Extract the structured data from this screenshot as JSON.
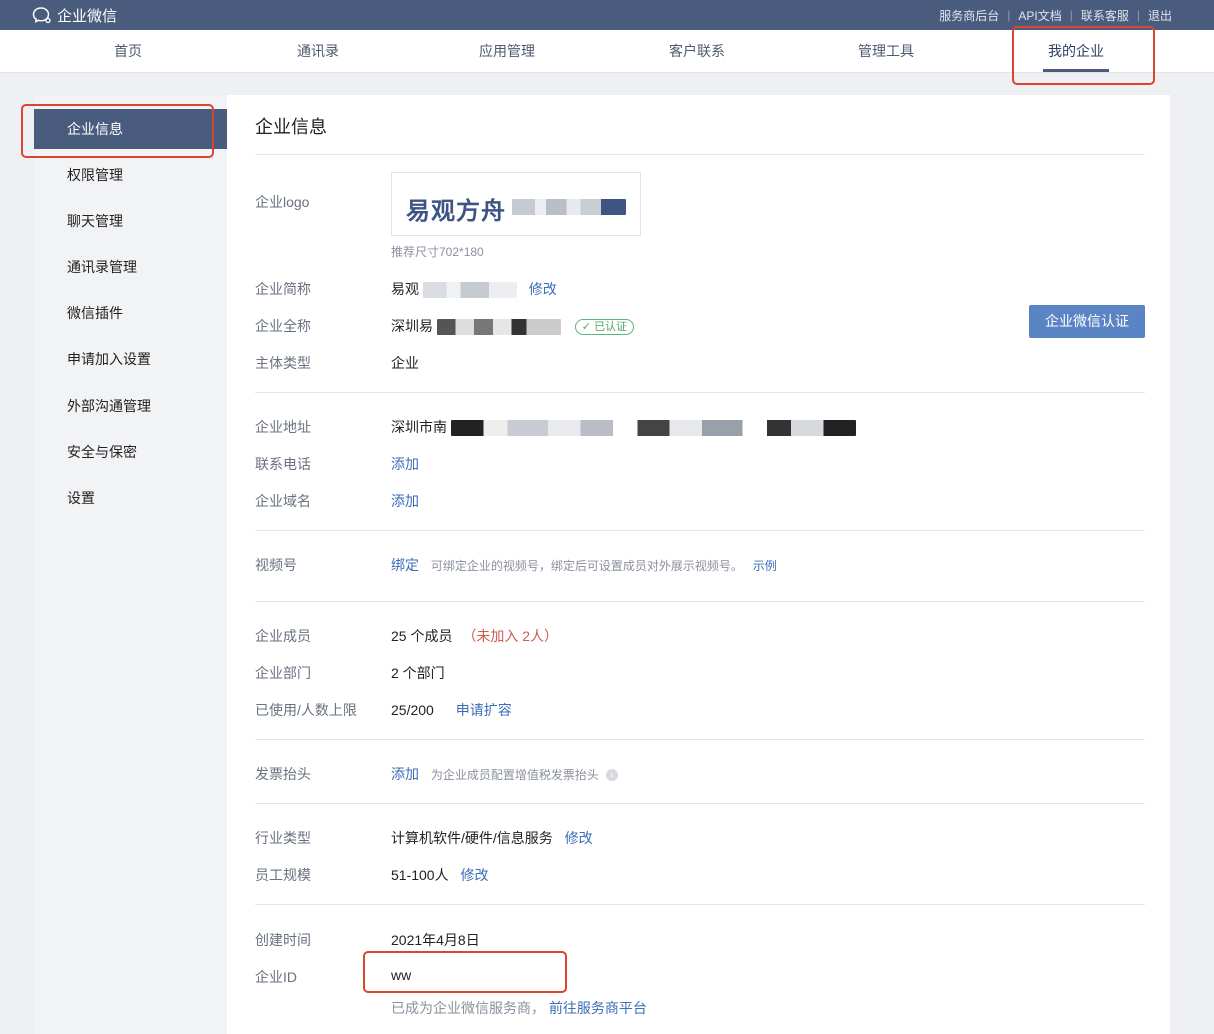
{
  "topbar": {
    "brand": "企业微信",
    "links": [
      "服务商后台",
      "API文档",
      "联系客服",
      "退出"
    ]
  },
  "nav": {
    "items": [
      "首页",
      "通讯录",
      "应用管理",
      "客户联系",
      "管理工具",
      "我的企业"
    ],
    "active_index": 5
  },
  "sidebar": {
    "items": [
      "企业信息",
      "权限管理",
      "聊天管理",
      "通讯录管理",
      "微信插件",
      "申请加入设置",
      "外部沟通管理",
      "安全与保密",
      "设置"
    ],
    "active_index": 0
  },
  "content": {
    "title": "企业信息",
    "logo": {
      "label": "企业logo",
      "text": "易观方舟",
      "hint": "推荐尺寸702*180"
    },
    "short_name": {
      "label": "企业简称",
      "value": "易观",
      "action": "修改"
    },
    "full_name": {
      "label": "企业全称",
      "value": "深圳易",
      "badge": "已认证"
    },
    "verify_button": "企业微信认证",
    "subject_type": {
      "label": "主体类型",
      "value": "企业"
    },
    "address": {
      "label": "企业地址",
      "value": "深圳市南"
    },
    "phone": {
      "label": "联系电话",
      "action": "添加"
    },
    "domain": {
      "label": "企业域名",
      "action": "添加"
    },
    "video": {
      "label": "视频号",
      "action": "绑定",
      "hint": "可绑定企业的视频号，绑定后可设置成员对外展示视频号。",
      "example": "示例"
    },
    "members": {
      "label": "企业成员",
      "value": "25 个成员",
      "not_joined": "（未加入 2人）"
    },
    "departments": {
      "label": "企业部门",
      "value": "2 个部门"
    },
    "usage": {
      "label": "已使用/人数上限",
      "value": "25/200",
      "action": "申请扩容"
    },
    "invoice": {
      "label": "发票抬头",
      "action": "添加",
      "hint": "为企业成员配置增值税发票抬头"
    },
    "industry": {
      "label": "行业类型",
      "value": "计算机软件/硬件/信息服务",
      "action": "修改"
    },
    "scale": {
      "label": "员工规模",
      "value": "51-100人",
      "action": "修改"
    },
    "created": {
      "label": "创建时间",
      "value": "2021年4月8日"
    },
    "corp_id": {
      "label": "企业ID",
      "value": "ww"
    },
    "provider": {
      "text": "已成为企业微信服务商，",
      "link": "前往服务商平台"
    }
  },
  "colors": {
    "topbar": "#4a5c7d",
    "accent": "#3b6db8",
    "highlight": "#d9452f"
  }
}
